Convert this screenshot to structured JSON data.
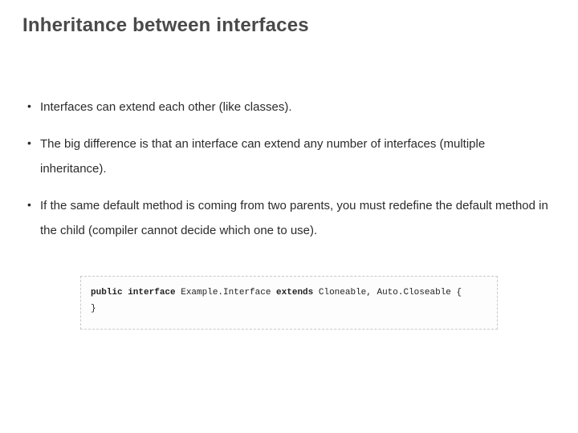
{
  "title": "Inheritance between interfaces",
  "bullets": [
    "Interfaces can extend each other (like classes).",
    "The big difference is that an interface can extend any number of interfaces (multiple inheritance).",
    "If the same default method is coming from two parents, you must redefine the default method in the child (compiler cannot decide which one to use)."
  ],
  "code": {
    "kw1": "public interface",
    "name": " Example.Interface ",
    "kw2": "extends",
    "rest": " Cloneable, Auto.Closeable {",
    "close": "}"
  }
}
